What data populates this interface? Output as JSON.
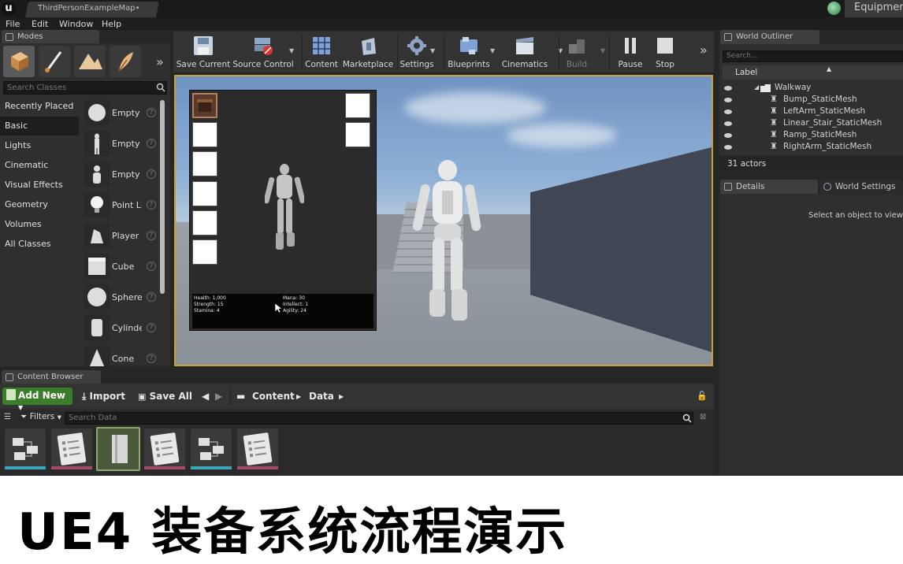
{
  "window": {
    "doc_tab": "ThirdPersonExampleMap•",
    "project_tab": "Equipmen"
  },
  "menu": [
    "File",
    "Edit",
    "Window",
    "Help"
  ],
  "modes": {
    "tab_label": "Modes",
    "search_placeholder": "Search Classes",
    "categories": [
      "Recently Placed",
      "Basic",
      "Lights",
      "Cinematic",
      "Visual Effects",
      "Geometry",
      "Volumes",
      "All Classes"
    ],
    "items": [
      "Empty A",
      "Empty C",
      "Empty P",
      "Point Li",
      "Player S",
      "Cube",
      "Sphere",
      "Cylinde",
      "Cone"
    ],
    "more": "»"
  },
  "toolbar": {
    "buttons": [
      "Save Current",
      "Source Control",
      "Content",
      "Marketplace",
      "Settings",
      "Blueprints",
      "Cinematics",
      "Build",
      "Pause",
      "Stop"
    ],
    "more": "»"
  },
  "inventory": {
    "stats": {
      "health": "Health: 1,000",
      "strength": "Strength: 15",
      "stamina": "Stamina: 4",
      "mana": "Mana: 30",
      "intellect": "Intellect: 1",
      "agility": "Agility: 24"
    }
  },
  "outliner": {
    "tab_label": "World Outliner",
    "search_placeholder": "Search...",
    "column_label": "Label",
    "folder": "Walkway",
    "items": [
      "Bump_StaticMesh",
      "LeftArm_StaticMesh",
      "Linear_Stair_StaticMesh",
      "Ramp_StaticMesh",
      "RightArm_StaticMesh"
    ],
    "actor_count": "31 actors"
  },
  "details": {
    "tab_details": "Details",
    "tab_world_settings": "World Settings",
    "empty_message": "Select an object to view d"
  },
  "content_browser": {
    "tab_label": "Content Browser",
    "add_new": "Add New",
    "import": "Import",
    "save_all": "Save All",
    "path": [
      "Content",
      "Data"
    ],
    "filters": "Filters",
    "search_placeholder": "Search Data"
  },
  "caption": "UE4 装备系统流程演示"
}
